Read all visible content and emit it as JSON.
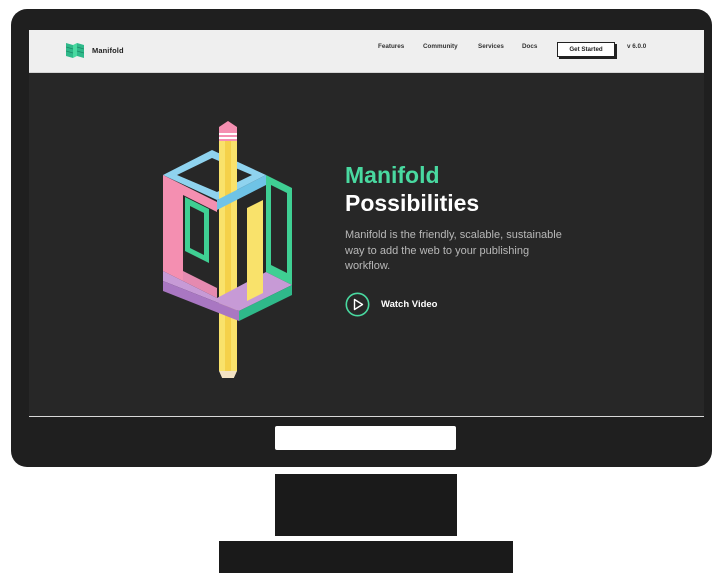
{
  "header": {
    "brand_name": "Manifold",
    "nav": {
      "features": "Features",
      "community": "Community",
      "services": "Services",
      "docs": "Docs",
      "get_started": "Get Started",
      "version": "v 6.0.0"
    }
  },
  "hero": {
    "title_line_1": "Manifold",
    "title_line_2": "Possibilities",
    "description": "Manifold is the friendly, scalable, sustainable way to add the web to your publishing workflow.",
    "watch_label": "Watch Video",
    "icons": {
      "logo": "manifold-logo-icon",
      "play": "play-circle-icon",
      "illustration": "pencil-cube-illustration"
    }
  },
  "colors": {
    "accent_green": "#49d9a0",
    "screen_bg": "#272727",
    "header_bg": "#efefef",
    "frame": "#1f1f1f"
  }
}
